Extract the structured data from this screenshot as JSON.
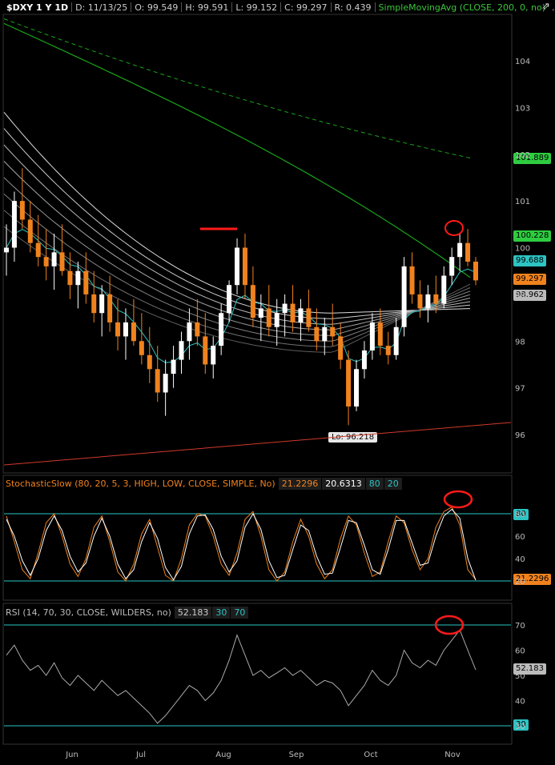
{
  "header": {
    "symbol": "$DXY 1 Y 1D",
    "date": "D: 11/13/25",
    "open": "O: 99.549",
    "high": "H: 99.591",
    "low": "L: 99.152",
    "close": "C: 99.297",
    "range": "R: 0.439",
    "study": "SimpleMovingAvg (CLOSE, 200, 0, no)",
    "more": "..."
  },
  "price_axis": [
    "104",
    "103",
    "102",
    "101",
    "100",
    "99",
    "98",
    "97",
    "96"
  ],
  "price_tags": {
    "sma200": "101.889",
    "sma_now": "100.228",
    "ema": "99.688",
    "last": "99.297",
    "ribbon": "98.962"
  },
  "low_label": "Lo: 96.218",
  "stoch": {
    "title": "StochasticSlow (80, 20, 5, 3, HIGH, LOW, CLOSE, SIMPLE, No)",
    "k": "21.2296",
    "d": "20.6313",
    "ob": "80",
    "os": "20",
    "axis": [
      "80",
      "60",
      "40",
      "20"
    ]
  },
  "rsi": {
    "title": "RSI (14, 70, 30, CLOSE, WILDERS, no)",
    "value": "52.183",
    "ob": "70",
    "os": "30",
    "axis": [
      "70",
      "60",
      "50",
      "40",
      "30"
    ]
  },
  "x_axis": [
    "Jun",
    "Jul",
    "Aug",
    "Sep",
    "Oct",
    "Nov"
  ],
  "colors": {
    "up": "#ffffff",
    "down": "#f0821e",
    "sma": "#19a319",
    "ema": "#2dc3c3",
    "marker": "#ff1a1a"
  },
  "chart_data": {
    "type": "candlestick",
    "period": "1 Y, daily",
    "ylim": [
      95.3,
      105.1
    ],
    "x_months": [
      "Jun",
      "Jul",
      "Aug",
      "Sep",
      "Oct",
      "Nov"
    ],
    "candles": [
      {
        "o": 99.9,
        "h": 100.5,
        "l": 99.4,
        "c": 100.0
      },
      {
        "o": 100.0,
        "h": 101.2,
        "l": 99.7,
        "c": 101.0
      },
      {
        "o": 101.0,
        "h": 101.7,
        "l": 100.4,
        "c": 100.6
      },
      {
        "o": 100.6,
        "h": 101.0,
        "l": 99.9,
        "c": 100.1
      },
      {
        "o": 100.1,
        "h": 100.7,
        "l": 99.6,
        "c": 99.8
      },
      {
        "o": 99.8,
        "h": 100.4,
        "l": 99.3,
        "c": 99.6
      },
      {
        "o": 99.6,
        "h": 100.3,
        "l": 99.1,
        "c": 99.9
      },
      {
        "o": 99.9,
        "h": 100.5,
        "l": 99.4,
        "c": 99.5
      },
      {
        "o": 99.5,
        "h": 99.9,
        "l": 98.9,
        "c": 99.2
      },
      {
        "o": 99.2,
        "h": 99.7,
        "l": 98.7,
        "c": 99.5
      },
      {
        "o": 99.5,
        "h": 99.9,
        "l": 98.8,
        "c": 99.0
      },
      {
        "o": 99.0,
        "h": 99.5,
        "l": 98.4,
        "c": 98.6
      },
      {
        "o": 98.6,
        "h": 99.2,
        "l": 98.1,
        "c": 99.0
      },
      {
        "o": 99.0,
        "h": 99.4,
        "l": 98.2,
        "c": 98.4
      },
      {
        "o": 98.4,
        "h": 98.9,
        "l": 97.8,
        "c": 98.1
      },
      {
        "o": 98.1,
        "h": 98.7,
        "l": 97.6,
        "c": 98.4
      },
      {
        "o": 98.4,
        "h": 98.9,
        "l": 97.9,
        "c": 98.0
      },
      {
        "o": 98.0,
        "h": 98.6,
        "l": 97.5,
        "c": 97.7
      },
      {
        "o": 97.7,
        "h": 98.3,
        "l": 97.1,
        "c": 97.4
      },
      {
        "o": 97.4,
        "h": 97.9,
        "l": 96.7,
        "c": 96.9
      },
      {
        "o": 96.9,
        "h": 97.6,
        "l": 96.4,
        "c": 97.3
      },
      {
        "o": 97.3,
        "h": 97.9,
        "l": 97.0,
        "c": 97.6
      },
      {
        "o": 97.6,
        "h": 98.2,
        "l": 97.3,
        "c": 98.0
      },
      {
        "o": 98.0,
        "h": 98.7,
        "l": 97.6,
        "c": 98.4
      },
      {
        "o": 98.4,
        "h": 98.9,
        "l": 97.9,
        "c": 98.1
      },
      {
        "o": 98.1,
        "h": 98.6,
        "l": 97.3,
        "c": 97.5
      },
      {
        "o": 97.5,
        "h": 98.1,
        "l": 97.2,
        "c": 97.9
      },
      {
        "o": 97.9,
        "h": 98.8,
        "l": 97.7,
        "c": 98.6
      },
      {
        "o": 98.6,
        "h": 99.3,
        "l": 98.4,
        "c": 99.2
      },
      {
        "o": 99.2,
        "h": 100.2,
        "l": 99.0,
        "c": 100.0
      },
      {
        "o": 100.0,
        "h": 100.3,
        "l": 98.9,
        "c": 99.2
      },
      {
        "o": 99.2,
        "h": 99.6,
        "l": 98.3,
        "c": 98.5
      },
      {
        "o": 98.5,
        "h": 99.0,
        "l": 98.0,
        "c": 98.7
      },
      {
        "o": 98.7,
        "h": 99.2,
        "l": 98.1,
        "c": 98.3
      },
      {
        "o": 98.3,
        "h": 98.9,
        "l": 97.9,
        "c": 98.6
      },
      {
        "o": 98.6,
        "h": 99.0,
        "l": 98.1,
        "c": 98.8
      },
      {
        "o": 98.8,
        "h": 99.2,
        "l": 98.2,
        "c": 98.4
      },
      {
        "o": 98.4,
        "h": 98.9,
        "l": 98.0,
        "c": 98.7
      },
      {
        "o": 98.7,
        "h": 99.1,
        "l": 98.2,
        "c": 98.3
      },
      {
        "o": 98.3,
        "h": 98.7,
        "l": 97.8,
        "c": 98.0
      },
      {
        "o": 98.0,
        "h": 98.5,
        "l": 97.7,
        "c": 98.3
      },
      {
        "o": 98.3,
        "h": 98.8,
        "l": 97.9,
        "c": 98.1
      },
      {
        "o": 98.1,
        "h": 98.4,
        "l": 97.4,
        "c": 97.6
      },
      {
        "o": 97.6,
        "h": 97.8,
        "l": 96.2,
        "c": 96.6
      },
      {
        "o": 96.6,
        "h": 97.6,
        "l": 96.5,
        "c": 97.4
      },
      {
        "o": 97.4,
        "h": 98.0,
        "l": 97.2,
        "c": 97.8
      },
      {
        "o": 97.8,
        "h": 98.6,
        "l": 97.6,
        "c": 98.4
      },
      {
        "o": 98.4,
        "h": 98.7,
        "l": 97.7,
        "c": 97.9
      },
      {
        "o": 97.9,
        "h": 98.2,
        "l": 97.5,
        "c": 97.7
      },
      {
        "o": 97.7,
        "h": 98.5,
        "l": 97.6,
        "c": 98.3
      },
      {
        "o": 98.3,
        "h": 99.8,
        "l": 98.1,
        "c": 99.6
      },
      {
        "o": 99.6,
        "h": 99.9,
        "l": 98.8,
        "c": 99.0
      },
      {
        "o": 99.0,
        "h": 99.3,
        "l": 98.5,
        "c": 98.7
      },
      {
        "o": 98.7,
        "h": 99.2,
        "l": 98.4,
        "c": 99.0
      },
      {
        "o": 99.0,
        "h": 99.4,
        "l": 98.6,
        "c": 98.8
      },
      {
        "o": 98.8,
        "h": 99.6,
        "l": 98.7,
        "c": 99.4
      },
      {
        "o": 99.4,
        "h": 100.0,
        "l": 99.2,
        "c": 99.8
      },
      {
        "o": 99.8,
        "h": 100.3,
        "l": 99.5,
        "c": 100.1
      },
      {
        "o": 100.1,
        "h": 100.4,
        "l": 99.6,
        "c": 99.7
      },
      {
        "o": 99.7,
        "h": 99.8,
        "l": 99.2,
        "c": 99.3
      }
    ],
    "price_labels": {
      "sma200": 101.889,
      "sma200_now": 100.228,
      "ema": 99.688,
      "last": 99.297,
      "ribbon": 98.962,
      "low": 96.218
    },
    "stochastic_slow": {
      "k": [
        78,
        55,
        30,
        22,
        45,
        72,
        80,
        60,
        35,
        24,
        40,
        68,
        78,
        55,
        28,
        20,
        35,
        62,
        75,
        50,
        25,
        20,
        40,
        70,
        80,
        78,
        60,
        35,
        25,
        45,
        75,
        82,
        60,
        30,
        20,
        28,
        55,
        75,
        60,
        35,
        22,
        30,
        58,
        78,
        70,
        45,
        24,
        28,
        55,
        78,
        72,
        48,
        30,
        40,
        68,
        82,
        86,
        70,
        30,
        21.2296
      ],
      "d": [
        75,
        60,
        38,
        25,
        40,
        65,
        78,
        65,
        42,
        28,
        36,
        60,
        76,
        60,
        35,
        22,
        30,
        55,
        72,
        58,
        32,
        21,
        33,
        62,
        78,
        79,
        66,
        42,
        28,
        38,
        68,
        80,
        66,
        38,
        23,
        25,
        48,
        70,
        65,
        42,
        26,
        27,
        50,
        74,
        72,
        52,
        30,
        26,
        48,
        74,
        74,
        54,
        34,
        36,
        60,
        78,
        84,
        76,
        40,
        20.6313
      ]
    },
    "rsi": [
      58,
      62,
      56,
      52,
      54,
      50,
      55,
      49,
      46,
      50,
      47,
      44,
      48,
      45,
      42,
      44,
      41,
      38,
      35,
      31,
      34,
      38,
      42,
      46,
      44,
      40,
      43,
      48,
      56,
      66,
      58,
      50,
      52,
      49,
      51,
      53,
      50,
      52,
      49,
      46,
      48,
      47,
      44,
      38,
      42,
      46,
      52,
      48,
      46,
      50,
      60,
      55,
      53,
      56,
      54,
      60,
      64,
      68,
      60,
      52.183
    ]
  }
}
